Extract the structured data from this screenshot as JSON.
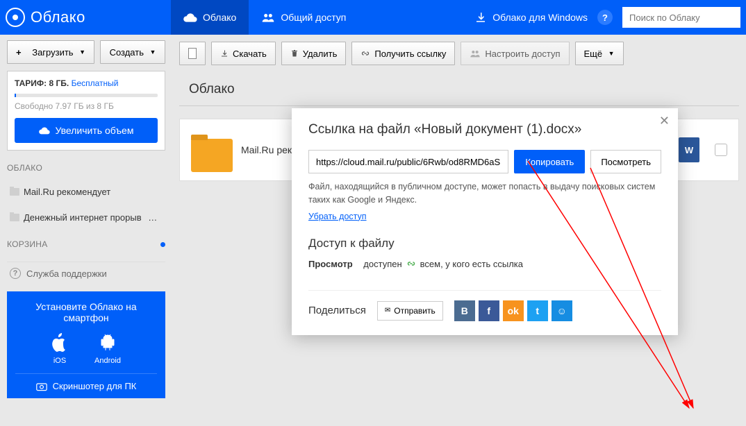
{
  "header": {
    "logo": "Облако",
    "tab_cloud": "Облако",
    "tab_shared": "Общий доступ",
    "download_win": "Облако для Windows",
    "search_placeholder": "Поиск по Облаку"
  },
  "sidebar": {
    "upload": "Загрузить",
    "create": "Создать",
    "plan_label": "ТАРИФ: 8 ГБ.",
    "plan_type": "Бесплатный",
    "free_space": "Свободно 7.97 ГБ из 8 ГБ",
    "enlarge": "Увеличить объем",
    "section_cloud": "ОБЛАКО",
    "tree1": "Mail.Ru рекомендует",
    "tree2": "Денежный интернет прорыв",
    "section_trash": "КОРЗИНА",
    "support": "Служба поддержки",
    "promo_title": "Установите Облако на смартфон",
    "ios": "iOS",
    "android": "Android",
    "screenshoter": "Скриншотер для ПК"
  },
  "toolbar": {
    "download": "Скачать",
    "delete": "Удалить",
    "getlink": "Получить ссылку",
    "access": "Настроить доступ",
    "more": "Ещё"
  },
  "breadcrumb": "Облако",
  "file": {
    "name_start": "Mail.Ru реком",
    "ext": ".docx"
  },
  "modal": {
    "title": "Ссылка на файл «Новый документ (1).docx»",
    "url": "https://cloud.mail.ru/public/6Rwb/od8RMD6aS",
    "copy": "Копировать",
    "view": "Посмотреть",
    "hint": "Файл, находящийся в публичном доступе, может попасть в выдачу поисковых систем таких как Google и Яндекс.",
    "remove": "Убрать доступ",
    "access_h": "Доступ к файлу",
    "access_view": "Просмотр",
    "access_avail": "доступен",
    "access_whom": "всем, у кого есть ссылка",
    "share_h": "Поделиться",
    "send": "Отправить"
  }
}
